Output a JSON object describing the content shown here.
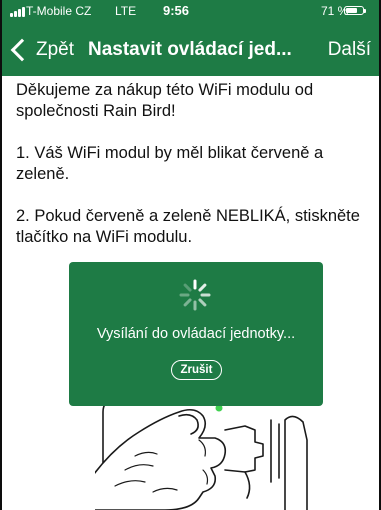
{
  "status_bar": {
    "carrier": "T-Mobile CZ",
    "network": "LTE",
    "time": "9:56",
    "battery": "71 %",
    "battery_level": 0.71
  },
  "nav": {
    "back_label": "Zpět",
    "title": "Nastavit ovládací jed...",
    "next_label": "Další"
  },
  "content": {
    "paragraphs": [
      "Děkujeme za nákup této WiFi modulu od společnosti Rain Bird!",
      "1. Váš WiFi modul by měl blikat červeně a zeleně.",
      "2. Pokud červeně a zeleně NEBLIKÁ, stiskněte tlačítko na WiFi modulu."
    ]
  },
  "dialog": {
    "message": "Vysílání do ovládací jednotky...",
    "cancel_label": "Zrušit"
  },
  "colors": {
    "brand_green": "#1e7b45",
    "led_green": "#3fd14f"
  }
}
